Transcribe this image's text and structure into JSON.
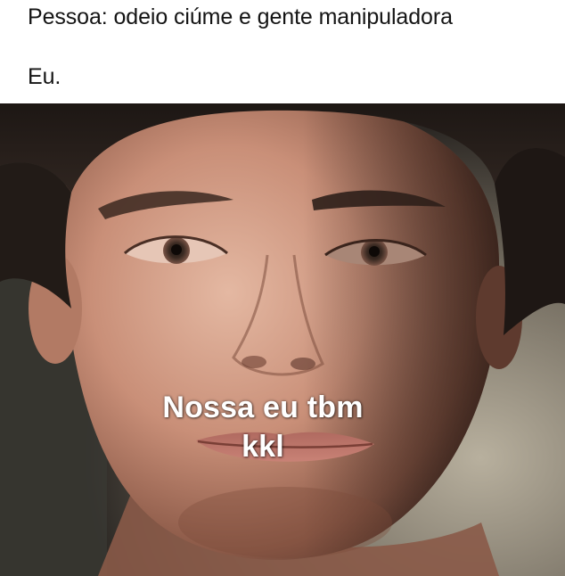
{
  "setup": {
    "line1": "Pessoa: odeio ciúme e gente manipuladora",
    "line2": "Eu."
  },
  "caption": {
    "line1": "Nossa eu tbm",
    "line2": "kkl"
  },
  "colors": {
    "background": "#ffffff",
    "setup_text": "#141414",
    "caption_text": "#ffffff"
  }
}
